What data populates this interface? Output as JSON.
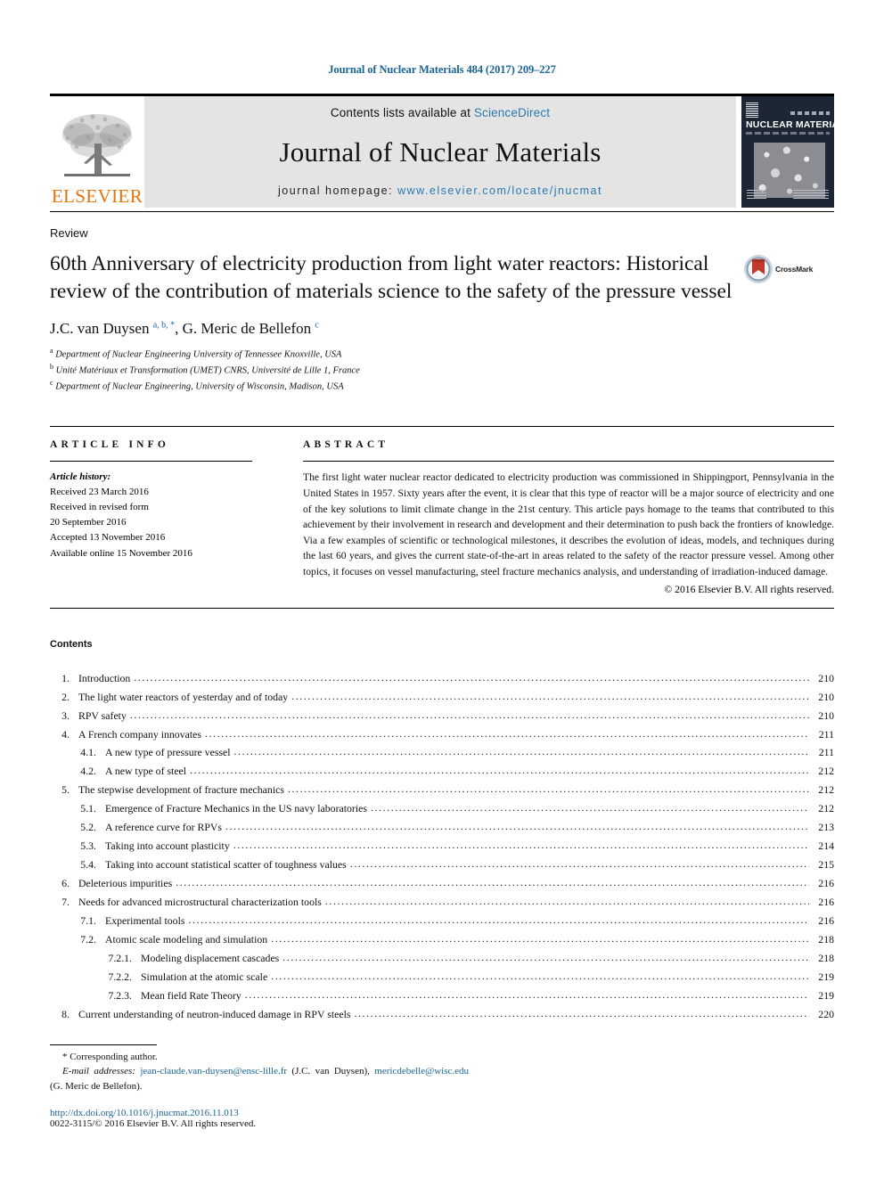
{
  "running_head": "Journal of Nuclear Materials 484 (2017) 209–227",
  "banner": {
    "publisher_logo_label": "ELSEVIER",
    "contents_prefix": "Contents lists available at ",
    "contents_link": "ScienceDirect",
    "journal_title": "Journal of Nuclear Materials",
    "homepage_prefix": "journal homepage: ",
    "homepage_link": "www.elsevier.com/locate/jnucmat",
    "cover_title": "NUCLEAR MATERIALS",
    "link_color": "#2a7ab0",
    "banner_bg": "#e4e4e4",
    "cover_bg": "#1d2635",
    "elsevier_orange": "#e8730c"
  },
  "article": {
    "type": "Review",
    "title": "60th Anniversary of electricity production from light water reactors: Historical review of the contribution of materials science to the safety of the pressure vessel",
    "crossmark_label": "CrossMark",
    "authors_html": "J.C. van Duysen <sup>a, b, *</sup>, G. Meric de Bellefon <sup>c</sup>",
    "affiliations": [
      {
        "marker": "a",
        "text": "Department of Nuclear Engineering University of Tennessee Knoxville, USA"
      },
      {
        "marker": "b",
        "text": "Unité Matériaux et Transformation (UMET) CNRS, Université de Lille 1, France"
      },
      {
        "marker": "c",
        "text": "Department of Nuclear Engineering, University of Wisconsin, Madison, USA"
      }
    ]
  },
  "article_info": {
    "heading": "ARTICLE INFO",
    "history_label": "Article history:",
    "history": [
      "Received 23 March 2016",
      "Received in revised form",
      "20 September 2016",
      "Accepted 13 November 2016",
      "Available online 15 November 2016"
    ]
  },
  "abstract": {
    "heading": "ABSTRACT",
    "body": "The first light water nuclear reactor dedicated to electricity production was commissioned in Shippingport, Pennsylvania in the United States in 1957. Sixty years after the event, it is clear that this type of reactor will be a major source of electricity and one of the key solutions to limit climate change in the 21st century. This article pays homage to the teams that contributed to this achievement by their involvement in research and development and their determination to push back the frontiers of knowledge. Via a few examples of scientific or technological milestones, it describes the evolution of ideas, models, and techniques during the last 60 years, and gives the current state-of-the-art in areas related to the safety of the reactor pressure vessel. Among other topics, it focuses on vessel manufacturing, steel fracture mechanics analysis, and understanding of irradiation-induced damage.",
    "copyright": "© 2016 Elsevier B.V. All rights reserved."
  },
  "contents": {
    "heading": "Contents",
    "entries": [
      {
        "level": 1,
        "number": "1.",
        "label": "Introduction",
        "page": "210"
      },
      {
        "level": 1,
        "number": "2.",
        "label": "The light water reactors of yesterday and of today",
        "page": "210"
      },
      {
        "level": 1,
        "number": "3.",
        "label": "RPV safety",
        "page": "210"
      },
      {
        "level": 1,
        "number": "4.",
        "label": "A French company innovates",
        "page": "211"
      },
      {
        "level": 2,
        "number": "4.1.",
        "label": "A new type of pressure vessel",
        "page": "211"
      },
      {
        "level": 2,
        "number": "4.2.",
        "label": "A new type of steel",
        "page": "212"
      },
      {
        "level": 1,
        "number": "5.",
        "label": "The stepwise development of fracture mechanics",
        "page": "212"
      },
      {
        "level": 2,
        "number": "5.1.",
        "label": "Emergence of Fracture Mechanics in the US navy laboratories",
        "page": "212"
      },
      {
        "level": 2,
        "number": "5.2.",
        "label": "A reference curve for RPVs",
        "page": "213"
      },
      {
        "level": 2,
        "number": "5.3.",
        "label": "Taking into account plasticity",
        "page": "214"
      },
      {
        "level": 2,
        "number": "5.4.",
        "label": "Taking into account statistical scatter of toughness values",
        "page": "215"
      },
      {
        "level": 1,
        "number": "6.",
        "label": "Deleterious impurities",
        "page": "216"
      },
      {
        "level": 1,
        "number": "7.",
        "label": "Needs for advanced microstructural characterization tools",
        "page": "216"
      },
      {
        "level": 2,
        "number": "7.1.",
        "label": "Experimental tools",
        "page": "216"
      },
      {
        "level": 2,
        "number": "7.2.",
        "label": "Atomic scale modeling and simulation",
        "page": "218"
      },
      {
        "level": 3,
        "number": "7.2.1.",
        "label": "Modeling displacement cascades",
        "page": "218"
      },
      {
        "level": 3,
        "number": "7.2.2.",
        "label": "Simulation at the atomic scale",
        "page": "219"
      },
      {
        "level": 3,
        "number": "7.2.3.",
        "label": "Mean field Rate Theory",
        "page": "219"
      },
      {
        "level": 1,
        "number": "8.",
        "label": "Current understanding of neutron-induced damage in RPV steels",
        "page": "220"
      }
    ]
  },
  "footer": {
    "corresponding_author": "* Corresponding author.",
    "email_label": "E-mail addresses:",
    "email_1": "jean-claude.van-duysen@ensc-lille.fr",
    "email_1_owner": "(J.C. van Duysen),",
    "email_2": "mericdebelle@wisc.edu",
    "email_2_owner": "(G. Meric de Bellefon).",
    "doi": "http://dx.doi.org/10.1016/j.jnucmat.2016.11.013",
    "issn": "0022-3115/© 2016 Elsevier B.V. All rights reserved."
  }
}
